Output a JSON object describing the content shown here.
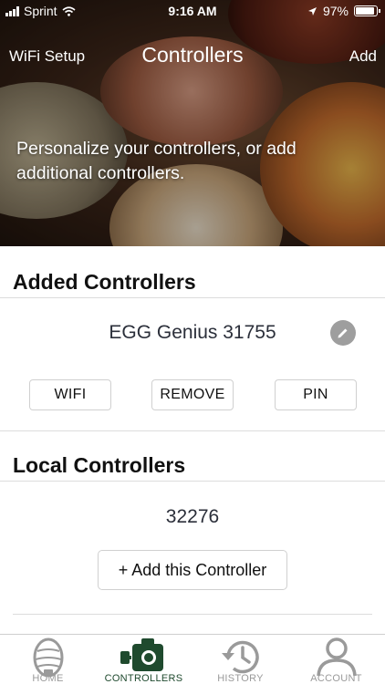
{
  "status_bar": {
    "carrier": "Sprint",
    "time": "9:16 AM",
    "battery_percent": "97%",
    "battery_level": 0.97
  },
  "nav": {
    "left_label": "WiFi Setup",
    "title": "Controllers",
    "right_label": "Add"
  },
  "hero": {
    "text": "Personalize your controllers, or add additional controllers."
  },
  "added_controllers": {
    "heading": "Added Controllers",
    "controller_name": "EGG Genius 31755",
    "buttons": {
      "wifi": "WIFI",
      "remove": "REMOVE",
      "pin": "PIN"
    }
  },
  "local_controllers": {
    "heading": "Local Controllers",
    "controller_id": "32276",
    "add_button": "+ Add this Controller"
  },
  "tabs": [
    {
      "label": "HOME",
      "icon": "egg-icon",
      "active": false
    },
    {
      "label": "CONTROLLERS",
      "icon": "controller-icon",
      "active": true
    },
    {
      "label": "HISTORY",
      "icon": "history-icon",
      "active": false
    },
    {
      "label": "ACCOUNT",
      "icon": "account-icon",
      "active": false
    }
  ],
  "colors": {
    "active_tab": "#1f4a2e",
    "inactive_tab": "#9a9a9a",
    "edit_button": "#9e9e9e"
  }
}
